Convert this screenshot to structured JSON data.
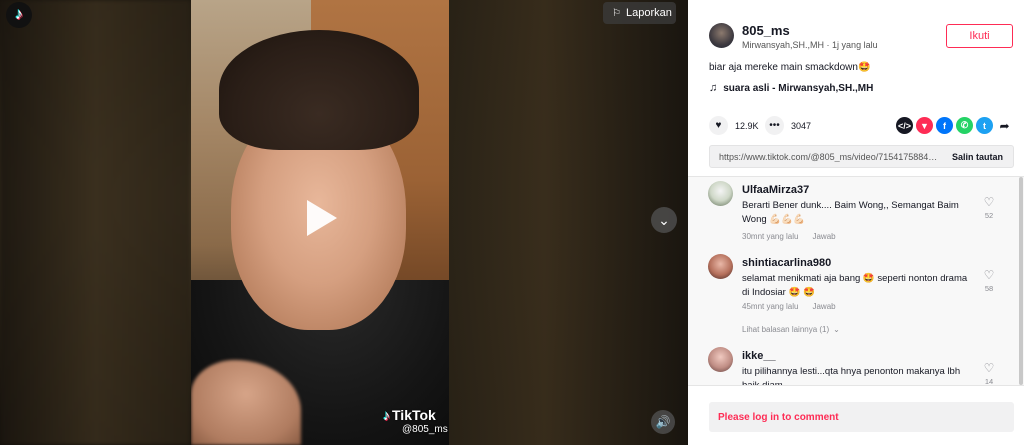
{
  "header": {
    "report_label": "Laporkan"
  },
  "video": {
    "watermark_brand": "TikTok",
    "watermark_user": "@805_ms"
  },
  "author": {
    "username": "805_ms",
    "display_name": "Mirwansyah,SH.,MH",
    "separator": "·",
    "time_ago": "1j yang lalu",
    "follow_label": "Ikuti"
  },
  "post": {
    "caption": "biar aja mereke main smackdown🤩",
    "sound": "suara asli - Mirwansyah,SH.,MH",
    "likes": "12.9K",
    "comments_count": "3047",
    "link": "https://www.tiktok.com/@805_ms/video/7154175884860...",
    "copy_label": "Salin tautan"
  },
  "share_icons": [
    "embed-icon",
    "send-icon",
    "facebook-icon",
    "whatsapp-icon",
    "twitter-icon",
    "share-arrow-icon"
  ],
  "comments": [
    {
      "username": "UlfaaMirza37",
      "text": "Berarti Bener dunk.... Baim Wong,, Semangat Baim Wong 💪🏻💪🏻💪🏻",
      "time": "30mnt yang lalu",
      "reply_label": "Jawab",
      "likes": "52"
    },
    {
      "username": "shintiacarlina980",
      "text": "selamat menikmati aja bang 🤩 seperti nonton drama di Indosiar 🤩 🤩",
      "time": "45mnt yang lalu",
      "reply_label": "Jawab",
      "likes": "58"
    },
    {
      "username": "ikke__",
      "text": "itu pilihannya lesti...qta hnya penonton makanya lbh baik diam",
      "likes": "14"
    }
  ],
  "more_replies_label": "Lihat balasan lainnya (1)",
  "login_prompt": "Please log in to comment",
  "colors": {
    "accent": "#fe2c55",
    "facebook": "#0075fa",
    "whatsapp": "#25d366",
    "twitter": "#1da1f2",
    "send": "#fe2c55",
    "embed": "#161823"
  }
}
